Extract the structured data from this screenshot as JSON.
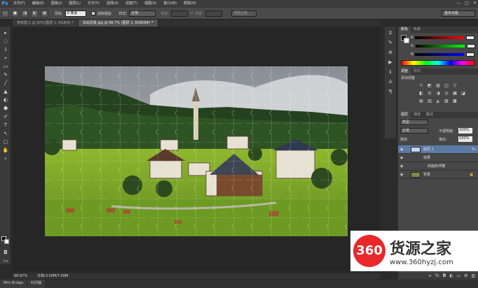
{
  "app": {
    "logo": "Ps"
  },
  "menu": [
    "文件(F)",
    "编辑(E)",
    "图像(I)",
    "图层(L)",
    "文字(Y)",
    "选择(S)",
    "滤镜(T)",
    "视图(V)",
    "窗口(W)",
    "帮助(H)"
  ],
  "window_controls": [
    "—",
    "□",
    "×"
  ],
  "options": {
    "feather_label": "羽化:",
    "feather_value": "0 像素",
    "antialias_label": "消除锯齿",
    "style_label": "样式:",
    "style_value": "正常",
    "width_label": "宽度:",
    "height_label": "高度:",
    "refine_label": "调整边缘...",
    "workspace": "基本功能"
  },
  "tabs": [
    {
      "label": "未标题-1 @ 50%(图层 1, RGB/8) *",
      "active": false
    },
    {
      "label": "冰岛风景.jpg @ 66.7% (图层 1, RGB/8#) *",
      "active": true
    }
  ],
  "tools": [
    "▸",
    "◌",
    "ʖ",
    "⌖",
    "▭",
    "✎",
    "╱",
    "▲",
    "◐",
    "⬢",
    "✐",
    "T",
    "↖",
    "▢",
    "✋",
    "⌕"
  ],
  "status": {
    "zoom": "66.67%",
    "doc": "文档:3.00M/7.00M"
  },
  "bottom_tabs": [
    "Mini Bridge",
    "时间轴"
  ],
  "panels": {
    "color": {
      "tabs": [
        "颜色",
        "色板"
      ],
      "channels": [
        "R",
        "G",
        "B"
      ],
      "colors": {
        "r": "#d42a2a",
        "g": "#2a9c2a",
        "b": "#2a4ad4"
      }
    },
    "adjust": {
      "tabs": [
        "调整",
        "样式"
      ],
      "title": "添加调整",
      "icons": [
        "☼",
        "◩",
        "▨",
        "◫",
        "▽",
        "◧",
        "⚖",
        "◑",
        "◎",
        "▦",
        "◪",
        "▤",
        "▥",
        "◭",
        "▧",
        "▩"
      ]
    },
    "layers": {
      "tabs": [
        "图层",
        "通道",
        "路径"
      ],
      "kind": "类型",
      "blend": "正常",
      "opacity_label": "不透明度:",
      "opacity_value": "100%",
      "lock_label": "锁定:",
      "fill_label": "填充:",
      "fill_value": "100%",
      "items": [
        {
          "name": "图层 1",
          "fx": "fx",
          "selected": true
        },
        {
          "name": "效果",
          "selected": false
        },
        {
          "name": "斜面和浮雕",
          "selected": false
        },
        {
          "name": "背景",
          "selected": false
        }
      ]
    }
  },
  "watermark": {
    "number": "360",
    "title": "货源之家",
    "url": "www.360hyzj.com"
  }
}
